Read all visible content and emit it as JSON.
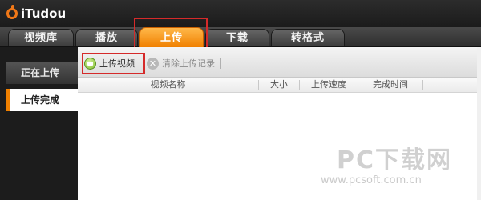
{
  "app": {
    "logo_text": "iTudou",
    "accent_color": "#f08000"
  },
  "tabs": [
    {
      "label": "视频库"
    },
    {
      "label": "播放"
    },
    {
      "label": "上传",
      "active": true
    },
    {
      "label": "下载"
    },
    {
      "label": "转格式"
    }
  ],
  "sidebar": {
    "items": [
      {
        "label": "正在上传"
      },
      {
        "label": "上传完成",
        "selected": true
      }
    ]
  },
  "toolbar": {
    "upload_label": "上传视频",
    "upload_icon": "upload-video-icon",
    "clear_label": "清除上传记录",
    "clear_icon": "clear-icon"
  },
  "table": {
    "columns": [
      "视频名称",
      "大小",
      "上传速度",
      "完成时间"
    ]
  },
  "watermark": {
    "main": "PC下载网",
    "sub": "www.pcsoft.com.cn"
  }
}
